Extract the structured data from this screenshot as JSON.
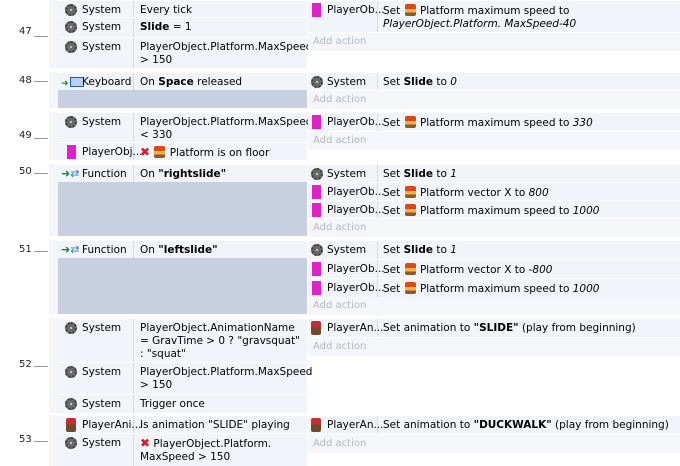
{
  "colors": {
    "object_magenta": "#e020c8",
    "background": "#c6d0e0",
    "row": "#f1f4f9",
    "add_action": "#b0b8c6",
    "negate": "#d21e1e"
  },
  "common": {
    "add_action": "Add action",
    "platform_word": "Platform"
  },
  "events": [
    {
      "line": "47",
      "conditions": [
        {
          "icon": "gear-icon",
          "object": "System",
          "text": "Every tick"
        },
        {
          "icon": "gear-icon",
          "object": "System",
          "text_bold": "Slide",
          "text_after": " = 1"
        },
        {
          "icon": "gear-icon",
          "object": "System",
          "text": "PlayerObject.Platform.MaxSpeed > 150"
        }
      ],
      "actions": [
        {
          "icon": "player-object-icon",
          "object": "PlayerOb...",
          "prefix": "Set",
          "after_icon": "Platform maximum speed to",
          "value_italic": "PlayerObject.Platform. MaxSpeed-40"
        }
      ]
    },
    {
      "line": "48",
      "trigger": {
        "icon": "keyboard-icon",
        "object": "Keyboard",
        "text_before": "On ",
        "text_bold": "Space",
        "text_after": " released"
      },
      "actions": [
        {
          "icon": "gear-icon",
          "object": "System",
          "prefix": "Set",
          "bold": "Slide",
          "middle": " to",
          "value_italic": "0"
        }
      ]
    },
    {
      "line": "49",
      "conditions": [
        {
          "icon": "gear-icon",
          "object": "System",
          "text": "PlayerObject.Platform.MaxSpeed < 330"
        },
        {
          "icon": "player-object-icon",
          "object": "PlayerObj...",
          "negated": true,
          "text": "Platform is on floor"
        }
      ],
      "actions": [
        {
          "icon": "player-object-icon",
          "object": "PlayerOb...",
          "prefix": "Set",
          "after_icon": "Platform maximum speed to",
          "value_italic": "330"
        }
      ]
    },
    {
      "line": "50",
      "trigger": {
        "icon": "function-icon",
        "object": "Function",
        "text_before": "On ",
        "text_bold": "\"rightslide\""
      },
      "actions": [
        {
          "icon": "gear-icon",
          "object": "System",
          "prefix": "Set",
          "bold": "Slide",
          "middle": " to",
          "value_italic": "1"
        },
        {
          "icon": "player-object-icon",
          "object": "PlayerOb...",
          "prefix": "Set",
          "after_icon": "Platform vector X to",
          "value_italic": "800"
        },
        {
          "icon": "player-object-icon",
          "object": "PlayerOb...",
          "prefix": "Set",
          "after_icon": "Platform maximum speed to",
          "value_italic": "1000"
        }
      ]
    },
    {
      "line": "51",
      "trigger": {
        "icon": "function-icon",
        "object": "Function",
        "text_before": "On ",
        "text_bold": "\"leftslide\""
      },
      "actions": [
        {
          "icon": "gear-icon",
          "object": "System",
          "prefix": "Set",
          "bold": "Slide",
          "middle": " to",
          "value_italic": "1"
        },
        {
          "icon": "player-object-icon",
          "object": "PlayerOb...",
          "prefix": "Set",
          "after_icon": "Platform vector X to",
          "value_italic": "-800"
        },
        {
          "icon": "player-object-icon",
          "object": "PlayerOb...",
          "prefix": "Set",
          "after_icon": "Platform maximum speed to",
          "value_italic": "1000"
        }
      ]
    },
    {
      "line": "52",
      "conditions": [
        {
          "icon": "gear-icon",
          "object": "System",
          "text": "PlayerObject.AnimationName = GravTime > 0 ? \"gravsquat\" : \"squat\""
        },
        {
          "icon": "gear-icon",
          "object": "System",
          "text": "PlayerObject.Platform.MaxSpeed > 150"
        },
        {
          "icon": "gear-icon",
          "object": "System",
          "text": "Trigger once"
        }
      ],
      "actions": [
        {
          "icon": "player-animation-icon",
          "object": "PlayerAn...",
          "prefix": "Set animation to",
          "bold": "\"SLIDE\"",
          "suffix": "(play from beginning)"
        }
      ]
    },
    {
      "line": "53",
      "conditions": [
        {
          "icon": "player-animation-icon",
          "object": "PlayerAni...",
          "text": "Is animation \"SLIDE\" playing"
        },
        {
          "icon": "gear-icon",
          "object": "System",
          "negated": true,
          "text": "PlayerObject.Platform. MaxSpeed > 150"
        }
      ],
      "actions": [
        {
          "icon": "player-animation-icon",
          "object": "PlayerAn...",
          "prefix": "Set animation to",
          "bold": "\"DUCKWALK\"",
          "suffix": "(play from beginning)"
        }
      ]
    }
  ]
}
